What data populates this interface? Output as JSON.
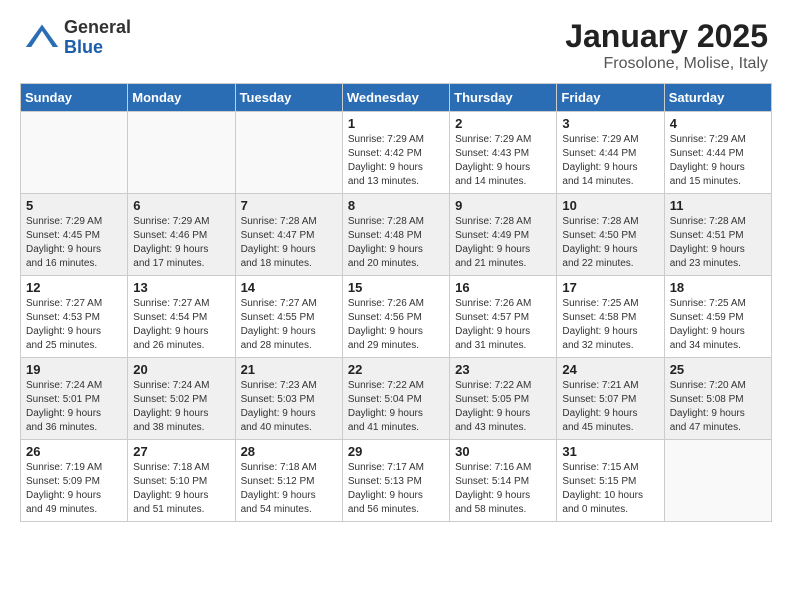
{
  "logo": {
    "general": "General",
    "blue": "Blue"
  },
  "title": "January 2025",
  "subtitle": "Frosolone, Molise, Italy",
  "weekdays": [
    "Sunday",
    "Monday",
    "Tuesday",
    "Wednesday",
    "Thursday",
    "Friday",
    "Saturday"
  ],
  "weeks": [
    [
      {
        "day": "",
        "info": ""
      },
      {
        "day": "",
        "info": ""
      },
      {
        "day": "",
        "info": ""
      },
      {
        "day": "1",
        "info": "Sunrise: 7:29 AM\nSunset: 4:42 PM\nDaylight: 9 hours\nand 13 minutes."
      },
      {
        "day": "2",
        "info": "Sunrise: 7:29 AM\nSunset: 4:43 PM\nDaylight: 9 hours\nand 14 minutes."
      },
      {
        "day": "3",
        "info": "Sunrise: 7:29 AM\nSunset: 4:44 PM\nDaylight: 9 hours\nand 14 minutes."
      },
      {
        "day": "4",
        "info": "Sunrise: 7:29 AM\nSunset: 4:44 PM\nDaylight: 9 hours\nand 15 minutes."
      }
    ],
    [
      {
        "day": "5",
        "info": "Sunrise: 7:29 AM\nSunset: 4:45 PM\nDaylight: 9 hours\nand 16 minutes."
      },
      {
        "day": "6",
        "info": "Sunrise: 7:29 AM\nSunset: 4:46 PM\nDaylight: 9 hours\nand 17 minutes."
      },
      {
        "day": "7",
        "info": "Sunrise: 7:28 AM\nSunset: 4:47 PM\nDaylight: 9 hours\nand 18 minutes."
      },
      {
        "day": "8",
        "info": "Sunrise: 7:28 AM\nSunset: 4:48 PM\nDaylight: 9 hours\nand 20 minutes."
      },
      {
        "day": "9",
        "info": "Sunrise: 7:28 AM\nSunset: 4:49 PM\nDaylight: 9 hours\nand 21 minutes."
      },
      {
        "day": "10",
        "info": "Sunrise: 7:28 AM\nSunset: 4:50 PM\nDaylight: 9 hours\nand 22 minutes."
      },
      {
        "day": "11",
        "info": "Sunrise: 7:28 AM\nSunset: 4:51 PM\nDaylight: 9 hours\nand 23 minutes."
      }
    ],
    [
      {
        "day": "12",
        "info": "Sunrise: 7:27 AM\nSunset: 4:53 PM\nDaylight: 9 hours\nand 25 minutes."
      },
      {
        "day": "13",
        "info": "Sunrise: 7:27 AM\nSunset: 4:54 PM\nDaylight: 9 hours\nand 26 minutes."
      },
      {
        "day": "14",
        "info": "Sunrise: 7:27 AM\nSunset: 4:55 PM\nDaylight: 9 hours\nand 28 minutes."
      },
      {
        "day": "15",
        "info": "Sunrise: 7:26 AM\nSunset: 4:56 PM\nDaylight: 9 hours\nand 29 minutes."
      },
      {
        "day": "16",
        "info": "Sunrise: 7:26 AM\nSunset: 4:57 PM\nDaylight: 9 hours\nand 31 minutes."
      },
      {
        "day": "17",
        "info": "Sunrise: 7:25 AM\nSunset: 4:58 PM\nDaylight: 9 hours\nand 32 minutes."
      },
      {
        "day": "18",
        "info": "Sunrise: 7:25 AM\nSunset: 4:59 PM\nDaylight: 9 hours\nand 34 minutes."
      }
    ],
    [
      {
        "day": "19",
        "info": "Sunrise: 7:24 AM\nSunset: 5:01 PM\nDaylight: 9 hours\nand 36 minutes."
      },
      {
        "day": "20",
        "info": "Sunrise: 7:24 AM\nSunset: 5:02 PM\nDaylight: 9 hours\nand 38 minutes."
      },
      {
        "day": "21",
        "info": "Sunrise: 7:23 AM\nSunset: 5:03 PM\nDaylight: 9 hours\nand 40 minutes."
      },
      {
        "day": "22",
        "info": "Sunrise: 7:22 AM\nSunset: 5:04 PM\nDaylight: 9 hours\nand 41 minutes."
      },
      {
        "day": "23",
        "info": "Sunrise: 7:22 AM\nSunset: 5:05 PM\nDaylight: 9 hours\nand 43 minutes."
      },
      {
        "day": "24",
        "info": "Sunrise: 7:21 AM\nSunset: 5:07 PM\nDaylight: 9 hours\nand 45 minutes."
      },
      {
        "day": "25",
        "info": "Sunrise: 7:20 AM\nSunset: 5:08 PM\nDaylight: 9 hours\nand 47 minutes."
      }
    ],
    [
      {
        "day": "26",
        "info": "Sunrise: 7:19 AM\nSunset: 5:09 PM\nDaylight: 9 hours\nand 49 minutes."
      },
      {
        "day": "27",
        "info": "Sunrise: 7:18 AM\nSunset: 5:10 PM\nDaylight: 9 hours\nand 51 minutes."
      },
      {
        "day": "28",
        "info": "Sunrise: 7:18 AM\nSunset: 5:12 PM\nDaylight: 9 hours\nand 54 minutes."
      },
      {
        "day": "29",
        "info": "Sunrise: 7:17 AM\nSunset: 5:13 PM\nDaylight: 9 hours\nand 56 minutes."
      },
      {
        "day": "30",
        "info": "Sunrise: 7:16 AM\nSunset: 5:14 PM\nDaylight: 9 hours\nand 58 minutes."
      },
      {
        "day": "31",
        "info": "Sunrise: 7:15 AM\nSunset: 5:15 PM\nDaylight: 10 hours\nand 0 minutes."
      },
      {
        "day": "",
        "info": ""
      }
    ]
  ]
}
